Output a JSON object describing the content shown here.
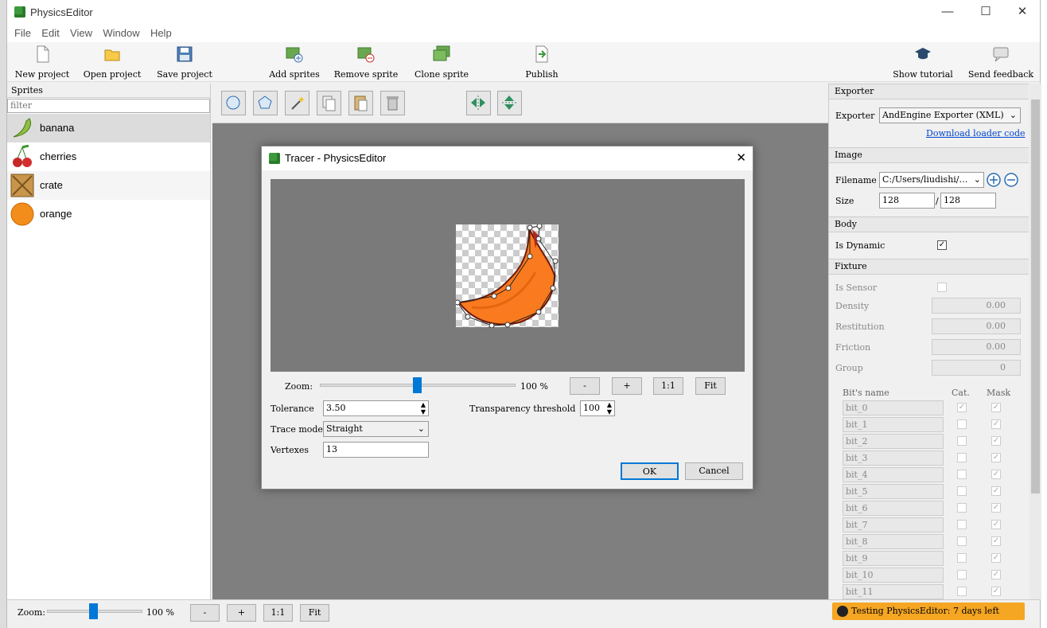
{
  "app": {
    "title": "PhysicsEditor"
  },
  "window_controls": {
    "minimize": "—",
    "maximize": "☐",
    "close": "✕"
  },
  "menu": [
    "File",
    "Edit",
    "View",
    "Window",
    "Help"
  ],
  "toolbar": {
    "new_project": "New project",
    "open_project": "Open project",
    "save_project": "Save project",
    "add_sprites": "Add sprites",
    "remove_sprite": "Remove sprite",
    "clone_sprite": "Clone sprite",
    "publish": "Publish",
    "show_tutorial": "Show tutorial",
    "send_feedback": "Send feedback"
  },
  "sprites_panel": {
    "header": "Sprites",
    "filter_placeholder": "filter",
    "items": [
      {
        "label": "banana",
        "icon": "banana-icon"
      },
      {
        "label": "cherries",
        "icon": "cherries-icon"
      },
      {
        "label": "crate",
        "icon": "crate-icon"
      },
      {
        "label": "orange",
        "icon": "orange-icon"
      }
    ]
  },
  "exporter": {
    "header": "Exporter",
    "label": "Exporter",
    "value": "AndEngine Exporter (XML)",
    "link": "Download loader code"
  },
  "image": {
    "header": "Image",
    "filename_label": "Filename",
    "filename_value": "C:/Users/liudishi/…",
    "size_label": "Size",
    "width": "128",
    "separator": "/",
    "height": "128"
  },
  "body": {
    "header": "Body",
    "is_dynamic_label": "Is Dynamic",
    "is_dynamic": "✓"
  },
  "fixture": {
    "header": "Fixture",
    "is_sensor_label": "Is Sensor",
    "density_label": "Density",
    "density": "0.00",
    "restitution_label": "Restitution",
    "restitution": "0.00",
    "friction_label": "Friction",
    "friction": "0.00",
    "group_label": "Group",
    "group": "0",
    "bits_header": "Bit's name",
    "cat_header": "Cat.",
    "mask_header": "Mask",
    "bits": [
      "bit_0",
      "bit_1",
      "bit_2",
      "bit_3",
      "bit_4",
      "bit_5",
      "bit_6",
      "bit_7",
      "bit_8",
      "bit_9",
      "bit_10",
      "bit_11"
    ],
    "check": "✓"
  },
  "bottom": {
    "zoom_label": "Zoom:",
    "zoom_value": "100 %",
    "minus": "-",
    "plus": "+",
    "one_to_one": "1:1",
    "fit": "Fit",
    "trial": "Testing PhysicsEditor: 7 days left"
  },
  "dialog": {
    "title": "Tracer - PhysicsEditor",
    "close": "✕",
    "zoom_label": "Zoom:",
    "zoom_value": "100 %",
    "minus": "-",
    "plus": "+",
    "one_to_one": "1:1",
    "fit": "Fit",
    "tolerance_label": "Tolerance",
    "tolerance": "3.50",
    "transparency_label": "Transparency threshold",
    "transparency": "100",
    "trace_mode_label": "Trace mode",
    "trace_mode": "Straight",
    "vertexes_label": "Vertexes",
    "vertexes": "13",
    "ok": "OK",
    "cancel": "Cancel"
  },
  "colors": {
    "accent": "#0078d7",
    "banana": "#f97a1f",
    "trial_badge": "#f5a623"
  }
}
